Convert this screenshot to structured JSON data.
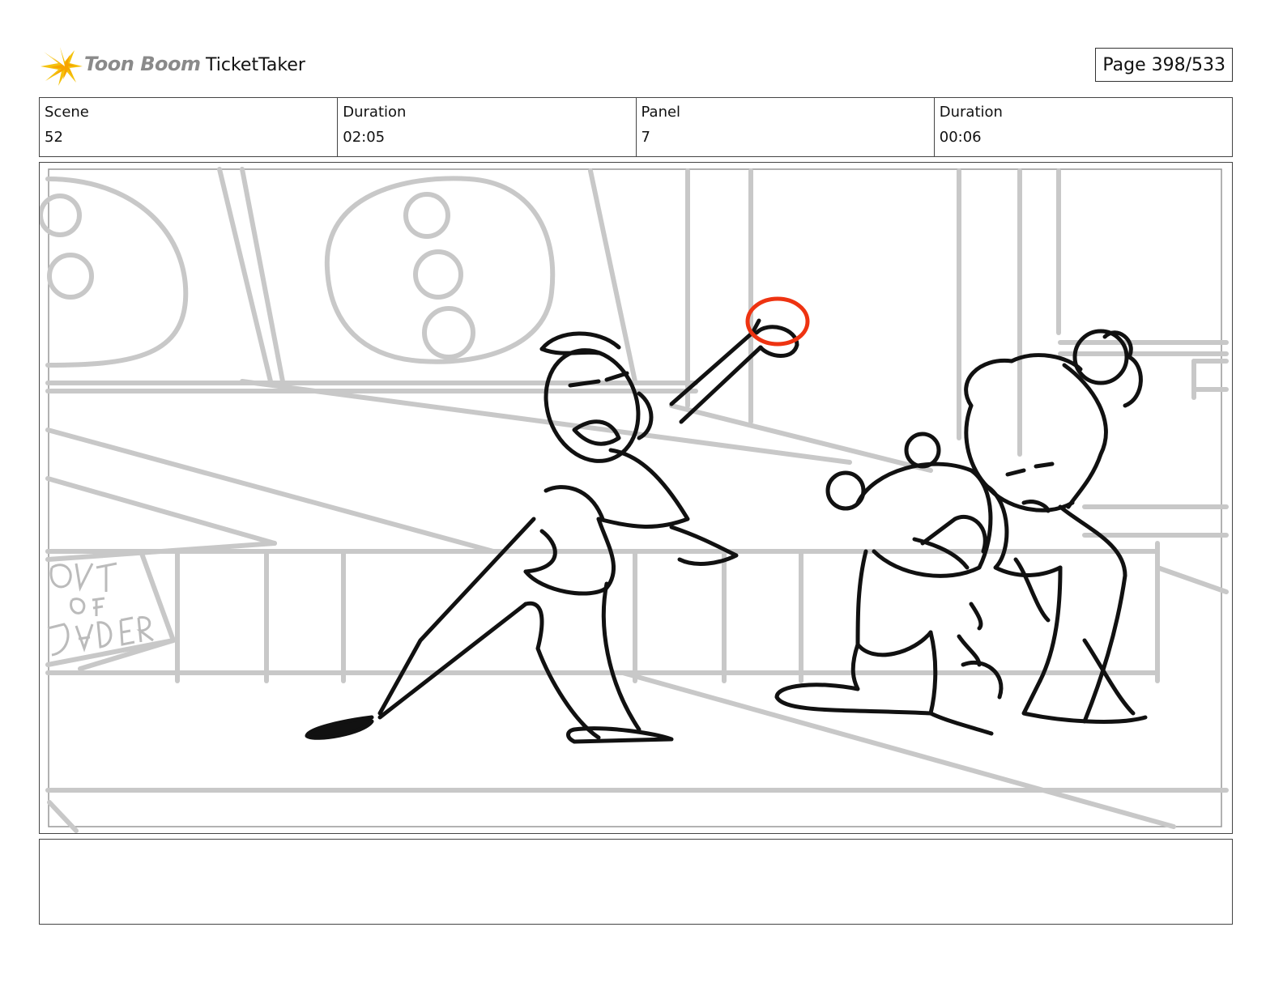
{
  "header": {
    "brand": "Toon Boom",
    "project": "TicketTaker",
    "page": "Page 398/533"
  },
  "info": {
    "scene_label": "Scene",
    "scene_value": "52",
    "scene_duration_label": "Duration",
    "scene_duration_value": "02:05",
    "panel_label": "Panel",
    "panel_value": "7",
    "panel_duration_label": "Duration",
    "panel_duration_value": "00:06"
  },
  "drawing": {
    "sign_text": "OUT OF ORDER",
    "line_color": "#111111",
    "background_line_color": "#c8c8c8",
    "highlight_color": "#ee3311"
  },
  "dialogue": ""
}
